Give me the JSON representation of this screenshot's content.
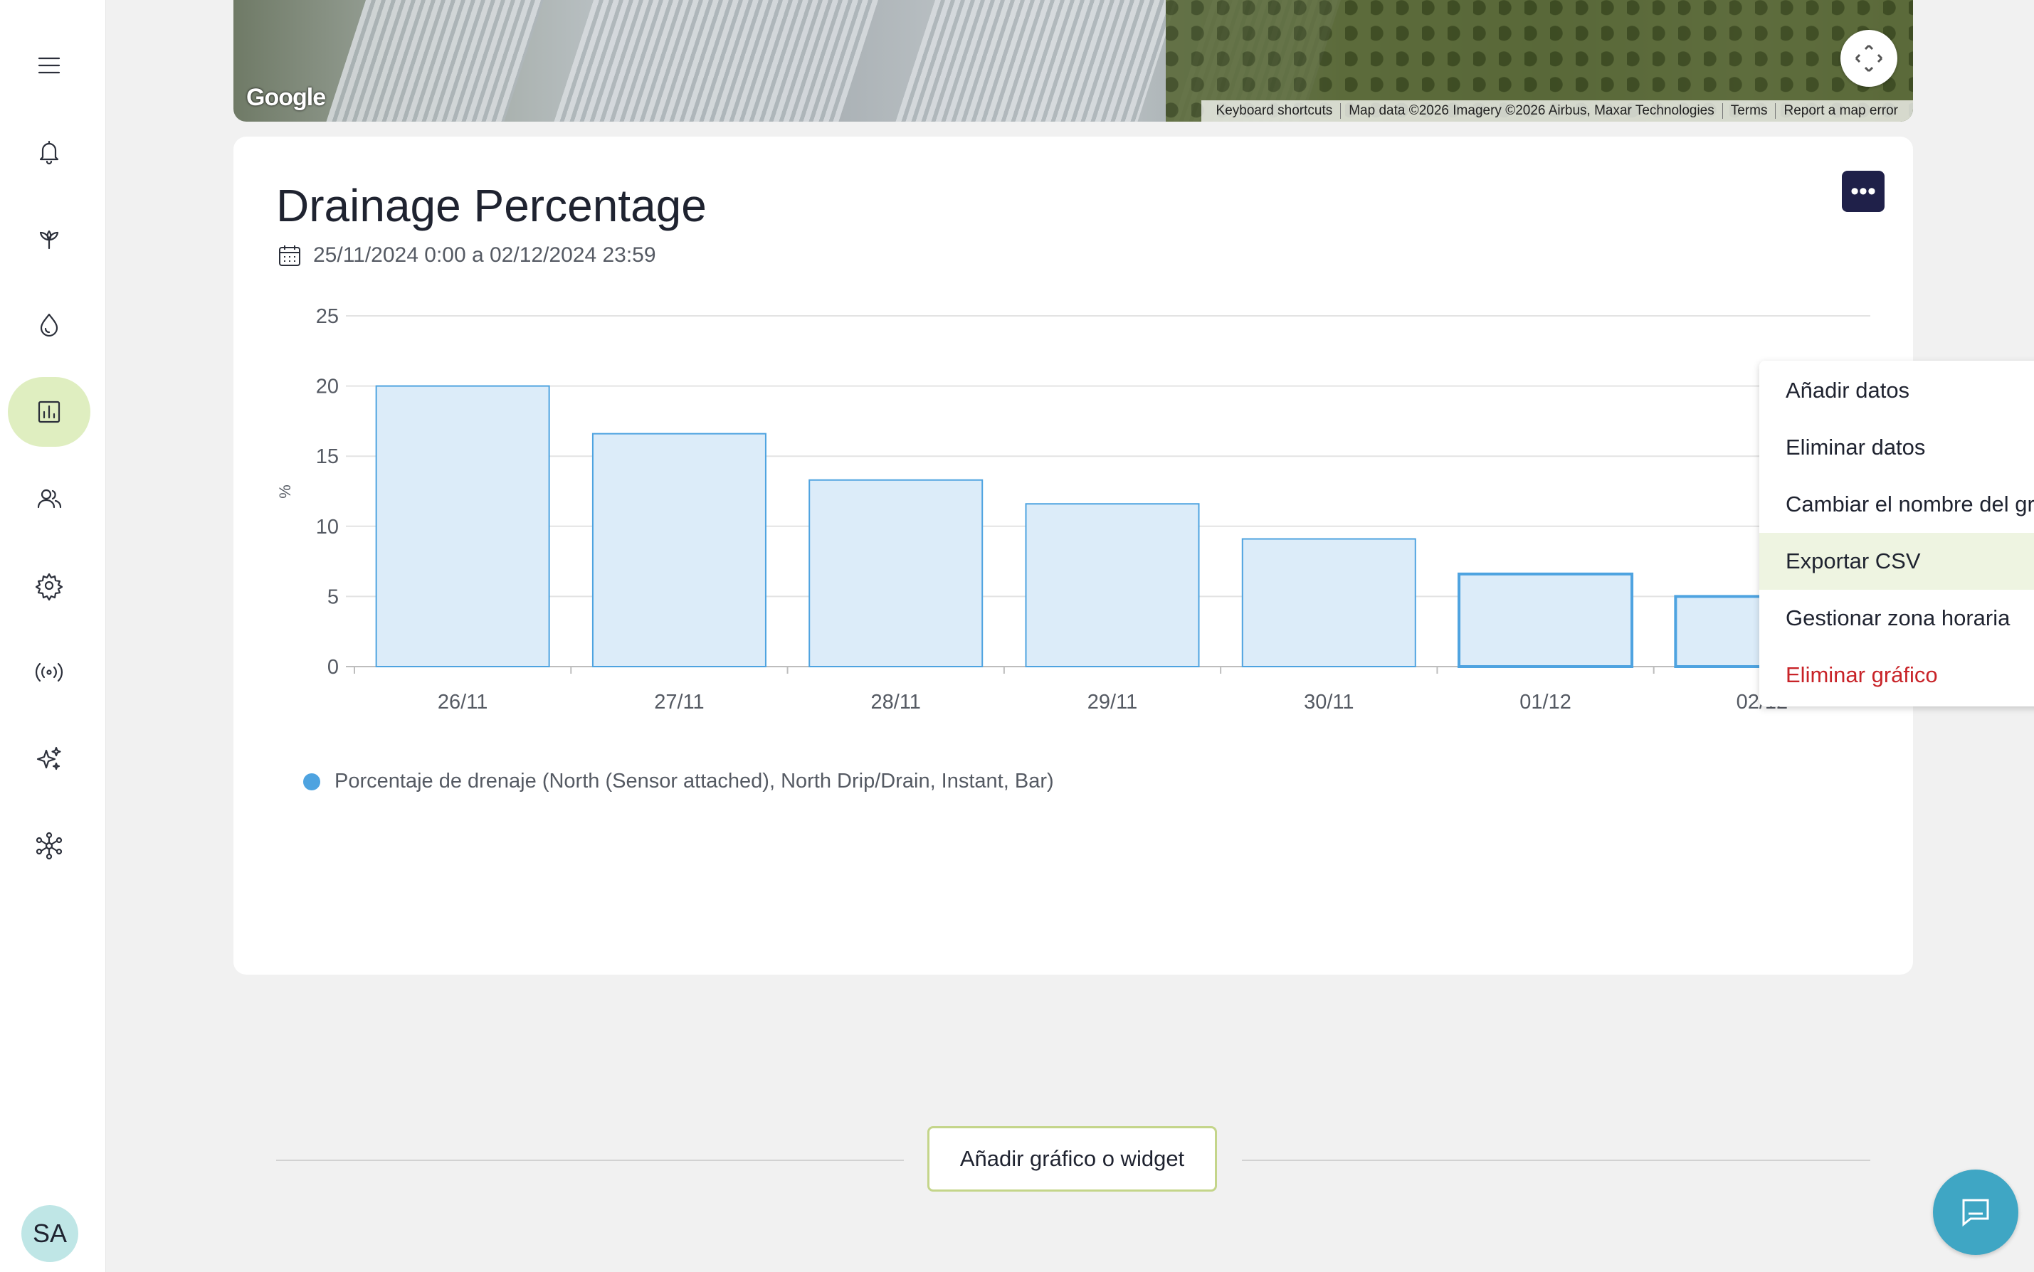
{
  "sidebar": {
    "items": [
      {
        "icon": "menu-icon"
      },
      {
        "icon": "bell-icon"
      },
      {
        "icon": "sprout-icon"
      },
      {
        "icon": "water-drop-icon"
      },
      {
        "icon": "chart-icon",
        "active": true
      },
      {
        "icon": "users-icon"
      },
      {
        "icon": "gear-icon"
      },
      {
        "icon": "signal-icon"
      },
      {
        "icon": "sparkles-icon"
      },
      {
        "icon": "network-icon"
      }
    ],
    "avatar_initials": "SA",
    "active_color": "#dfeec0"
  },
  "map": {
    "logo": "Google",
    "attribution": [
      "Keyboard shortcuts",
      "Map data ©2026 Imagery ©2026 Airbus, Maxar Technologies",
      "Terms",
      "Report a map error"
    ]
  },
  "card": {
    "title": "Drainage Percentage",
    "date_range": "25/11/2024 0:00 a 02/12/2024 23:59",
    "more_button": "•••"
  },
  "menu": {
    "items": [
      {
        "label": "Añadir datos"
      },
      {
        "label": "Eliminar datos"
      },
      {
        "label": "Cambiar el nombre del gráfico"
      },
      {
        "label": "Exportar CSV",
        "highlighted": true
      },
      {
        "label": "Gestionar zona horaria"
      },
      {
        "label": "Eliminar gráfico",
        "danger": true
      }
    ]
  },
  "chart_data": {
    "type": "bar",
    "title": "Drainage Percentage",
    "categories": [
      "26/11",
      "27/11",
      "28/11",
      "29/11",
      "30/11",
      "01/12",
      "02/12"
    ],
    "series": [
      {
        "name": "Porcentaje de drenaje (North (Sensor attached), North Drip/Drain, Instant, Bar)",
        "values": [
          20,
          16.6,
          13.3,
          11.6,
          9.1,
          6.6,
          5.0
        ],
        "color": "#4ea3e0",
        "fill": "#dcecf9"
      }
    ],
    "ylabel": "%",
    "xlabel": "",
    "ylim": [
      0,
      25
    ],
    "yticks": [
      0,
      5,
      10,
      15,
      20,
      25
    ],
    "grid": true,
    "legend": "bottom-left"
  },
  "add_widget_label": "Añadir gráfico o widget",
  "chat_icon": "chat-icon"
}
